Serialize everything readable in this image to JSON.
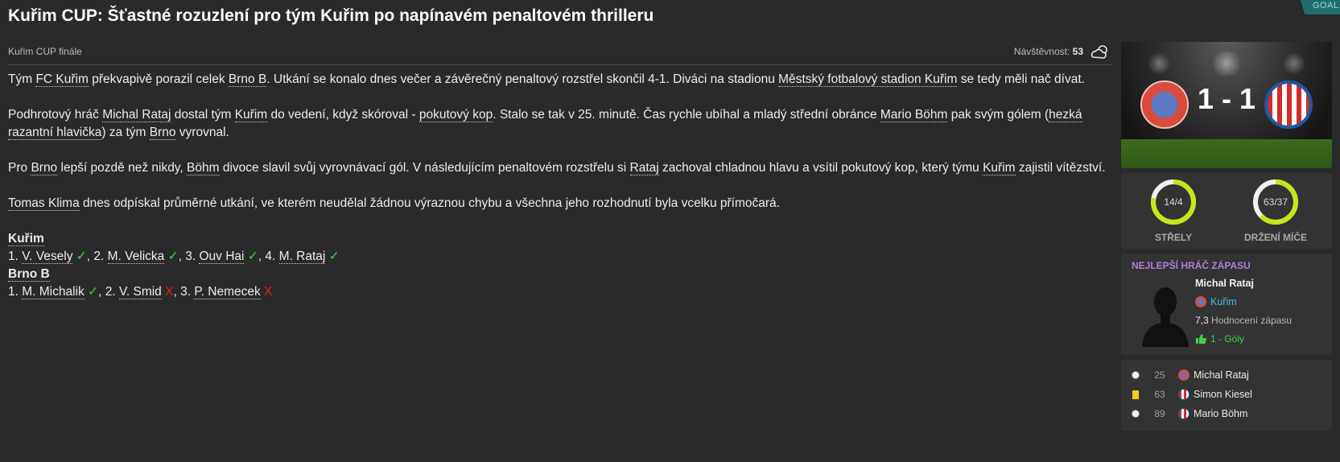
{
  "headline": "Kuřim CUP: Šťastné rozuzlení pro tým Kuřim po napínavém penaltovém thrilleru",
  "corner_tag": "GOAL",
  "competition": "Kuřim CUP finále",
  "attendance": {
    "label": "Návštěvnost:",
    "value": "53",
    "weather_icon": "cloudy-icon"
  },
  "article": {
    "p1": {
      "a": "Tým ",
      "team1": "FC Kuřim",
      "b": " překvapivě porazil celek ",
      "team2": "Brno B",
      "c": ". Utkání se konalo dnes večer a závěrečný penaltový rozstřel skončil 4-1. Diváci na stadionu ",
      "stadium": "Městský fotbalový stadion Kuřim",
      "d": " se tedy měli nač dívat."
    },
    "p2": {
      "a": "Podhrotový hráč ",
      "player1": "Michal Rataj",
      "b": " dostal tým ",
      "team1": "Kuřim",
      "c": " do vedení, když skóroval - ",
      "goal_type1": "pokutový kop",
      "d": ". Stalo se tak v 25. minutě. Čas rychle ubíhal a mladý střední obránce ",
      "player2": "Mario Böhm",
      "e": " pak svým gólem (",
      "goal_type2": "hezká razantní hlavička",
      "f": ") za tým ",
      "team2": "Brno",
      "g": " vyrovnal."
    },
    "p3": {
      "a": "Pro ",
      "team2": "Brno",
      "b": " lepší pozdě než nikdy, ",
      "player2": "Böhm",
      "c": " divoce slavil svůj vyrovnávací gól. V následujícím penaltovém rozstřelu si ",
      "player1": "Rataj",
      "d": " zachoval chladnou hlavu a vsítil pokutový kop, který týmu ",
      "team1": "Kuřim",
      "e": " zajistil vítězství."
    },
    "p4": {
      "referee": "Tomas Klima",
      "a": " dnes odpískal průměrné utkání, ve kterém neudělal žádnou výraznou chybu a všechna jeho rozhodnutí byla vcelku přímočará."
    }
  },
  "shootout": {
    "home": {
      "team": "Kuřim",
      "takers": [
        {
          "num": "1.",
          "name": "V. Vesely",
          "mark": "✓"
        },
        {
          "num": "2.",
          "name": "M. Velicka",
          "mark": "✓"
        },
        {
          "num": "3.",
          "name": "Ouv Hai",
          "mark": "✓"
        },
        {
          "num": "4.",
          "name": "M. Rataj",
          "mark": "✓"
        }
      ]
    },
    "away": {
      "team": "Brno B",
      "takers": [
        {
          "num": "1.",
          "name": "M. Michalik",
          "mark": "✓"
        },
        {
          "num": "2.",
          "name": "V. Smid",
          "mark": "X"
        },
        {
          "num": "3.",
          "name": "P. Nemecek",
          "mark": "X"
        }
      ]
    }
  },
  "scoreboard": {
    "score": "1 - 1",
    "home_crest": "fc-kurim-crest",
    "away_crest": "brno-crest"
  },
  "stats": {
    "shots": {
      "value": "14/4",
      "label": "STŘELY",
      "home_fraction": 0.78
    },
    "possession": {
      "value": "63/37",
      "label": "DRŽENÍ MÍČE",
      "home_fraction": 0.63
    },
    "ring_color": "#c8e617"
  },
  "best_player": {
    "title": "NEJLEPŠÍ HRÁČ ZÁPASU",
    "name": "Michal Rataj",
    "team": "Kuřim",
    "rating": "7,3",
    "rating_label": "Hodnocení zápasu",
    "goals": "1 - Góly"
  },
  "events": [
    {
      "type": "goal",
      "minute": "25",
      "player": "Michal Rataj",
      "team_crest": "home"
    },
    {
      "type": "yellow-card",
      "minute": "63",
      "player": "Simon Kiesel",
      "team_crest": "away"
    },
    {
      "type": "goal",
      "minute": "89",
      "player": "Mario Böhm",
      "team_crest": "away"
    }
  ]
}
